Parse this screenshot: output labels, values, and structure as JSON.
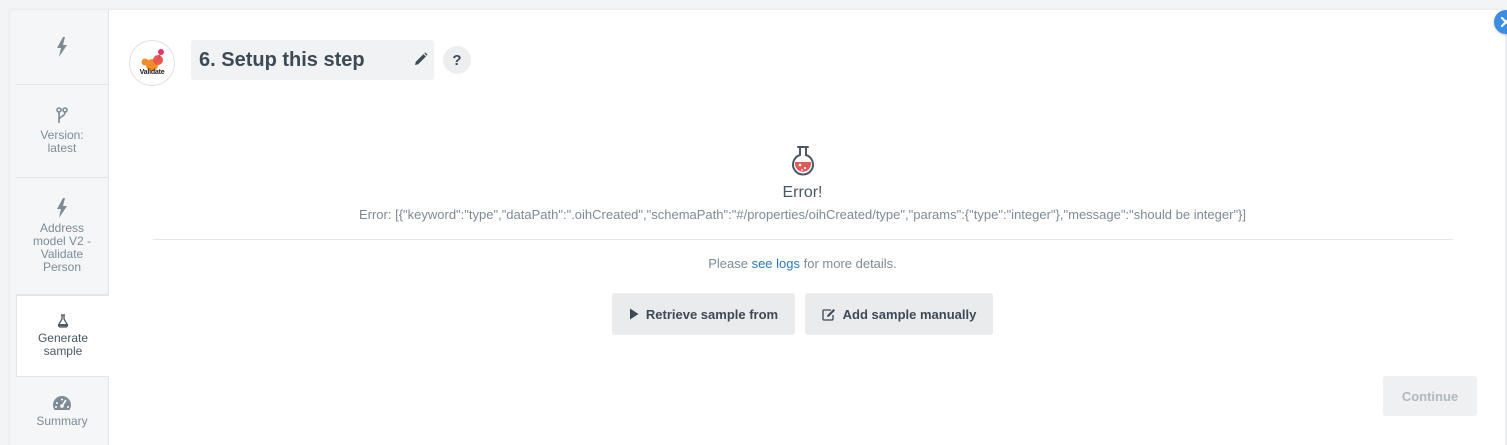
{
  "sidebar": {
    "items": [
      {
        "label": "",
        "icon": "bolt-icon"
      },
      {
        "label": "Version:\nlatest",
        "icon": "branch-icon"
      },
      {
        "label": "Address\nmodel V2 -\nValidate\nPerson",
        "icon": "bolt-icon"
      },
      {
        "label": "Generate\nsample",
        "icon": "flask-icon",
        "active": true
      },
      {
        "label": "Summary",
        "icon": "dashboard-icon"
      }
    ]
  },
  "step": {
    "logo_text": "Validate",
    "title": "6. Setup this step",
    "help": "?"
  },
  "error": {
    "title": "Error!",
    "message": "Error: [{\"keyword\":\"type\",\"dataPath\":\".oihCreated\",\"schemaPath\":\"#/properties/oihCreated/type\",\"params\":{\"type\":\"integer\"},\"message\":\"should be integer\"}]",
    "details_prefix": "Please ",
    "details_link": "see logs",
    "details_suffix": " for more details."
  },
  "actions": {
    "retrieve_label": "Retrieve sample from",
    "manual_label": "Add sample manually",
    "continue_label": "Continue"
  },
  "colors": {
    "accent": "#3c8ee4",
    "link": "#2a7ab8",
    "flask": "#e05a5a"
  }
}
